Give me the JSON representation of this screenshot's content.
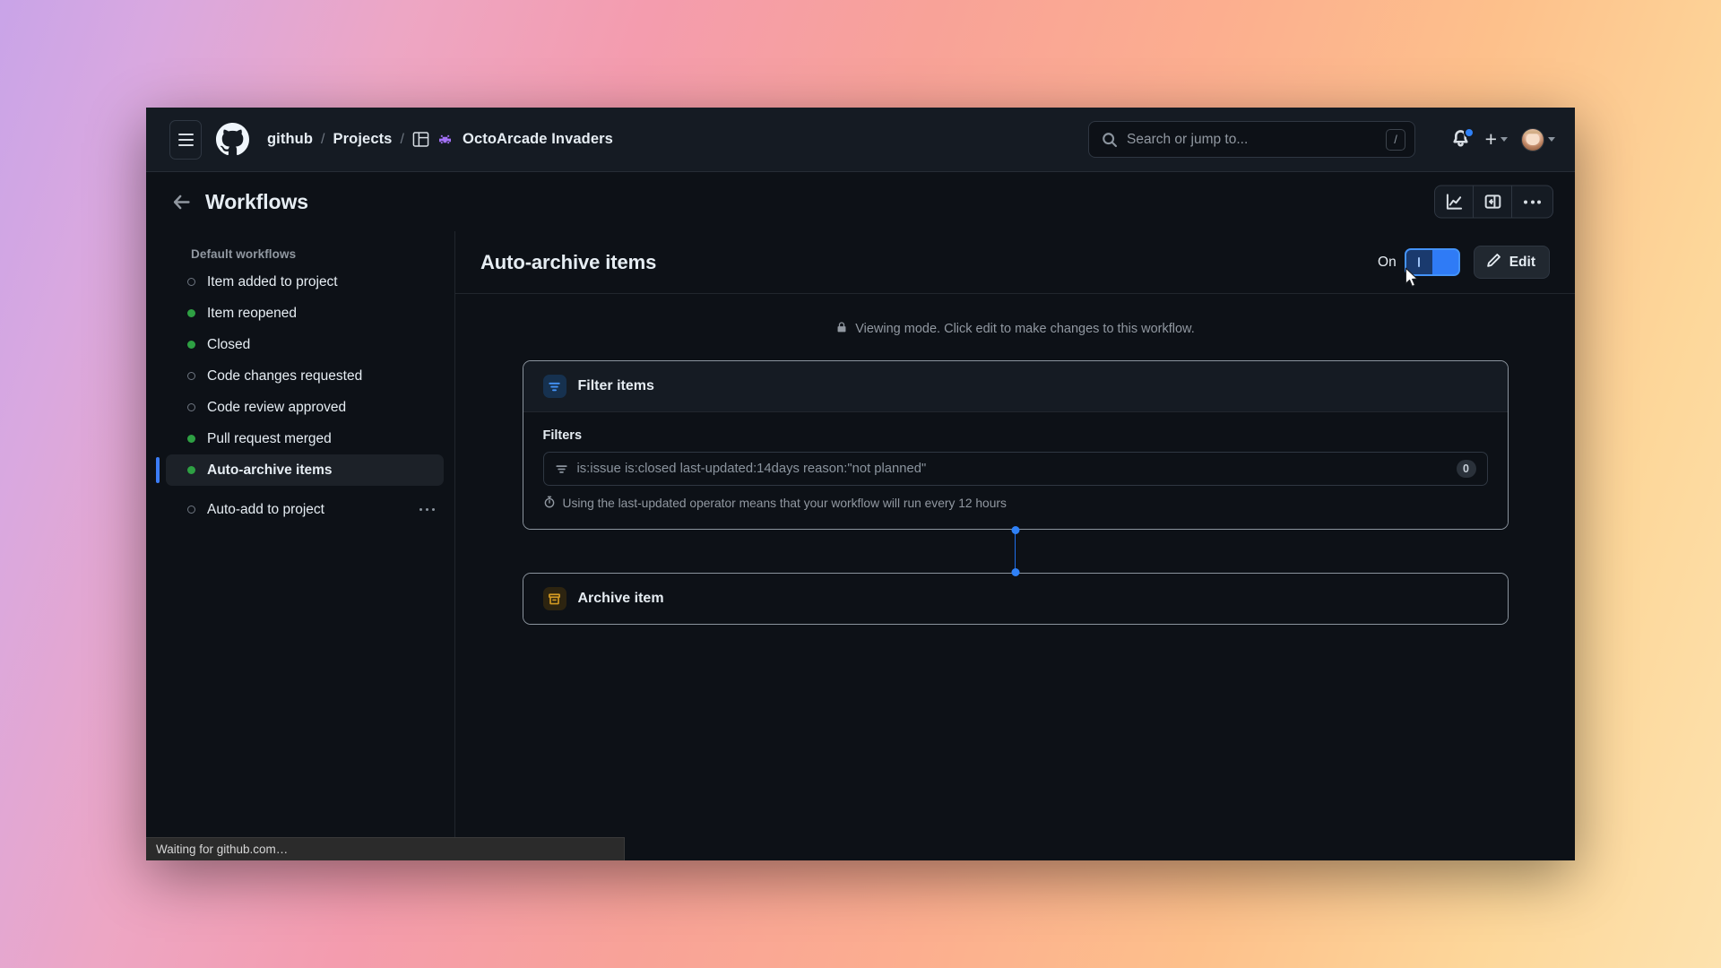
{
  "browser": {
    "status_bar_text": "Waiting for github.com…"
  },
  "header": {
    "menu_icon": "hamburger-icon",
    "logo_icon": "github-mark-icon",
    "breadcrumb": {
      "owner": "github",
      "section": "Projects",
      "project_icon": "project-table-icon",
      "project_emoji": "space-invader-icon",
      "project": "OctoArcade Invaders",
      "separator": "/"
    },
    "search": {
      "placeholder": "Search or jump to...",
      "icon": "search-icon",
      "shortcut_key": "/"
    },
    "actions": {
      "notifications_icon": "bell-icon",
      "notification_badge": true,
      "create_icon": "plus-icon",
      "create_caret": "chevron-down-icon",
      "avatar_icon": "user-avatar",
      "avatar_caret": "chevron-down-icon"
    }
  },
  "subheader": {
    "back_icon": "arrow-left-icon",
    "title": "Workflows",
    "actions": [
      {
        "name": "insights-icon"
      },
      {
        "name": "sidebar-toggle-icon"
      },
      {
        "name": "kebab-menu-icon"
      }
    ]
  },
  "sidebar": {
    "heading": "Default workflows",
    "items": [
      {
        "label": "Item added to project",
        "enabled": false,
        "selected": false,
        "has_menu": false
      },
      {
        "label": "Item reopened",
        "enabled": true,
        "selected": false,
        "has_menu": false
      },
      {
        "label": "Closed",
        "enabled": true,
        "selected": false,
        "has_menu": false
      },
      {
        "label": "Code changes requested",
        "enabled": false,
        "selected": false,
        "has_menu": false
      },
      {
        "label": "Code review approved",
        "enabled": false,
        "selected": false,
        "has_menu": false
      },
      {
        "label": "Pull request merged",
        "enabled": true,
        "selected": false,
        "has_menu": false
      },
      {
        "label": "Auto-archive items",
        "enabled": true,
        "selected": true,
        "has_menu": false
      }
    ],
    "custom_items": [
      {
        "label": "Auto-add to project",
        "enabled": false,
        "selected": false,
        "has_menu": true
      }
    ]
  },
  "panel": {
    "title": "Auto-archive items",
    "toggle": {
      "label": "On",
      "state": "on",
      "accent_color": "#1f6feb"
    },
    "edit_button": {
      "label": "Edit",
      "icon": "pencil-icon"
    },
    "viewing_banner": {
      "icon": "lock-icon",
      "text": "Viewing mode. Click edit to make changes to this workflow."
    },
    "nodes": {
      "filter_card": {
        "icon": "filter-icon",
        "icon_color": "#4493f8",
        "title": "Filter items",
        "field_label": "Filters",
        "filter_input": {
          "icon": "filter-icon",
          "value": "is:issue is:closed last-updated:14days reason:\"not planned\"",
          "count_badge": "0"
        },
        "hint": {
          "icon": "stopwatch-icon",
          "text": "Using the last-updated operator means that your workflow will run every 12 hours"
        }
      },
      "connector": {
        "color": "#2f81f7"
      },
      "action_card": {
        "icon": "archive-icon",
        "icon_color": "#d29922",
        "title": "Archive item"
      }
    }
  }
}
